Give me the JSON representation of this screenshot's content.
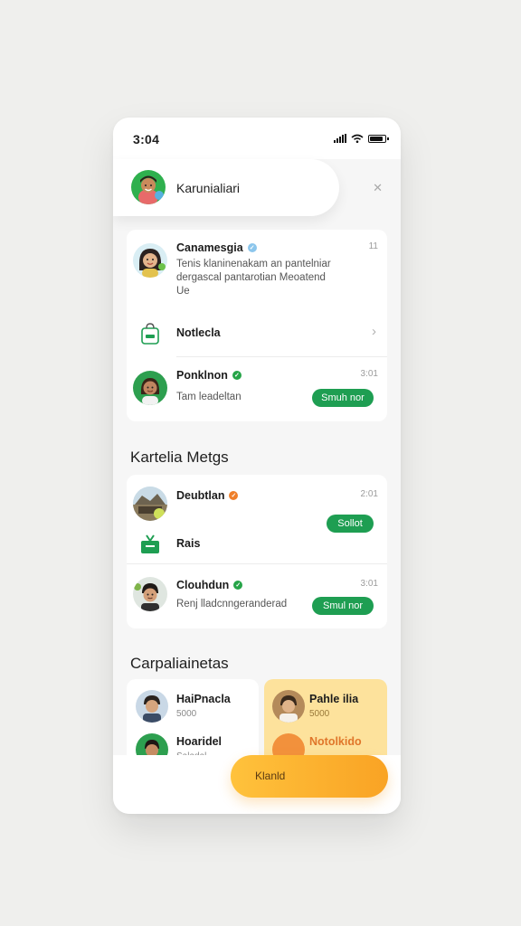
{
  "status_bar": {
    "time": "3:04"
  },
  "profile": {
    "name": "Karunialiari"
  },
  "close_icon": "close-icon",
  "card1": {
    "message": {
      "name": "Canamesgia",
      "time": "11",
      "lines": [
        "Tenis klaninenakam an pantelniar",
        "dergascal pantarotian Meoatend",
        "Ue"
      ]
    },
    "folder": {
      "label": "Notlecla"
    },
    "contact": {
      "name": "Ponklnon",
      "time": "3:01",
      "subtitle": "Tam leadeltan",
      "button": "Smuh nor"
    }
  },
  "section1": {
    "title": "Kartelia Metgs"
  },
  "card2": {
    "item1": {
      "name": "Deubtlan",
      "time": "2:01",
      "button": "Sollot"
    },
    "item2": {
      "label": "Rais"
    },
    "item3": {
      "name": "Clouhdun",
      "time": "3:01",
      "subtitle": "Renj lladcnngeranderad",
      "button": "Smul nor"
    }
  },
  "section2": {
    "title": "Carpaliainetas"
  },
  "grid": {
    "left": [
      {
        "name": "HaiPnacla",
        "sub": "5000"
      },
      {
        "name": "Hoaridel",
        "sub": "Saladal"
      }
    ],
    "right": [
      {
        "name": "Pahle ilia",
        "sub": "5000"
      },
      {
        "name": "Notolkido",
        "sub": ""
      }
    ]
  },
  "cta": {
    "label": "Klanld"
  },
  "colors": {
    "brand_green": "#1e9e52",
    "accent_orange": "#f9a324",
    "highlight_yellow": "#fde29c",
    "verified_green": "#26a448"
  }
}
